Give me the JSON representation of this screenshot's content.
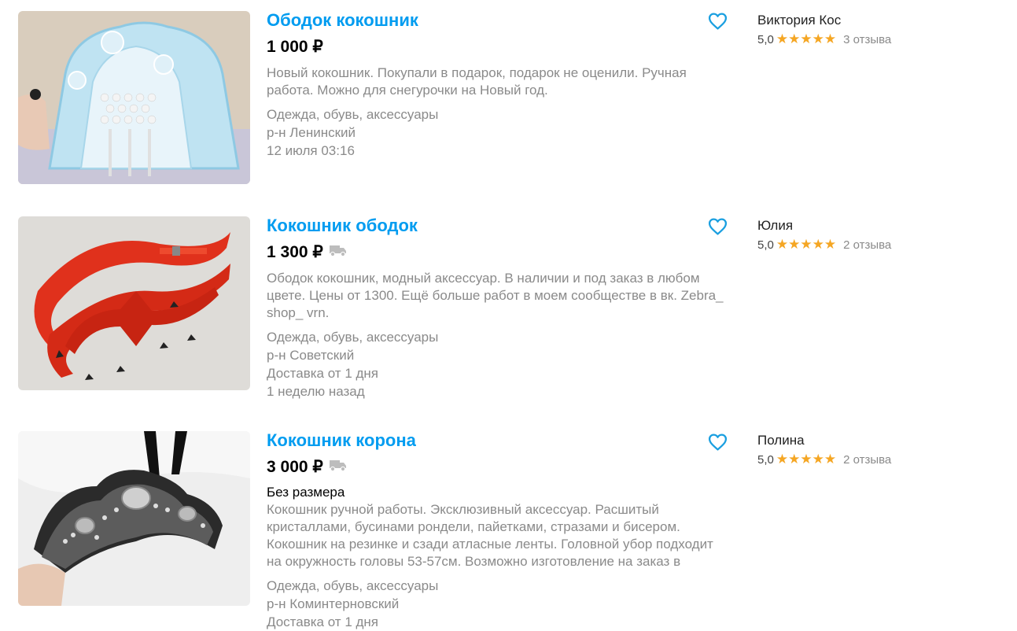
{
  "listings": [
    {
      "title": "Ободок кокошник",
      "price": "1 000 ₽",
      "delivery_icon": false,
      "size": "",
      "description": "Новый кокошник. Покупали в подарок, подарок не оценили. Ручная работа. Можно для снегурочки на Новый год.",
      "category": "Одежда, обувь, аксессуары",
      "district": "р-н Ленинский",
      "delivery": "",
      "date": "12 июля 03:16",
      "seller": {
        "name": "Виктория Кос",
        "rating": "5,0",
        "stars": "★★★★★",
        "reviews": "3 отзыва"
      }
    },
    {
      "title": "Кокошник ободок",
      "price": "1 300 ₽",
      "delivery_icon": true,
      "size": "",
      "description": "Ободок кокошник, модный аксессуар. В наличии и под заказ в любом цвете. Цены от 1300. Ещё больше работ в моем сообществе в вк. Zebra_ shop_ vrn.",
      "category": "Одежда, обувь, аксессуары",
      "district": "р-н Советский",
      "delivery": "Доставка от 1 дня",
      "date": "1 неделю назад",
      "seller": {
        "name": "Юлия",
        "rating": "5,0",
        "stars": "★★★★★",
        "reviews": "2 отзыва"
      }
    },
    {
      "title": "Кокошник корона",
      "price": "3 000 ₽",
      "delivery_icon": true,
      "size": "Без размера",
      "description": "Кокошник ручной работы. Эксклюзивный аксессуар. Расшитый кристаллами, бусинами рондели, пайетками, стразами и бисером. Кокошник на резинке и сзади атласные ленты. Головной убор подходит на окружность головы 53-57см. Возможно изготовление на заказ в",
      "category": "Одежда, обувь, аксессуары",
      "district": "р-н Коминтерновский",
      "delivery": "Доставка от 1 дня",
      "date": "",
      "seller": {
        "name": "Полина",
        "rating": "5,0",
        "stars": "★★★★★",
        "reviews": "2 отзыва"
      }
    }
  ],
  "colors": {
    "link": "#009cf0",
    "star": "#f5a623",
    "muted": "#8a8a8a"
  },
  "icons": {
    "favorite": "heart-outline-icon",
    "delivery": "truck-icon"
  }
}
